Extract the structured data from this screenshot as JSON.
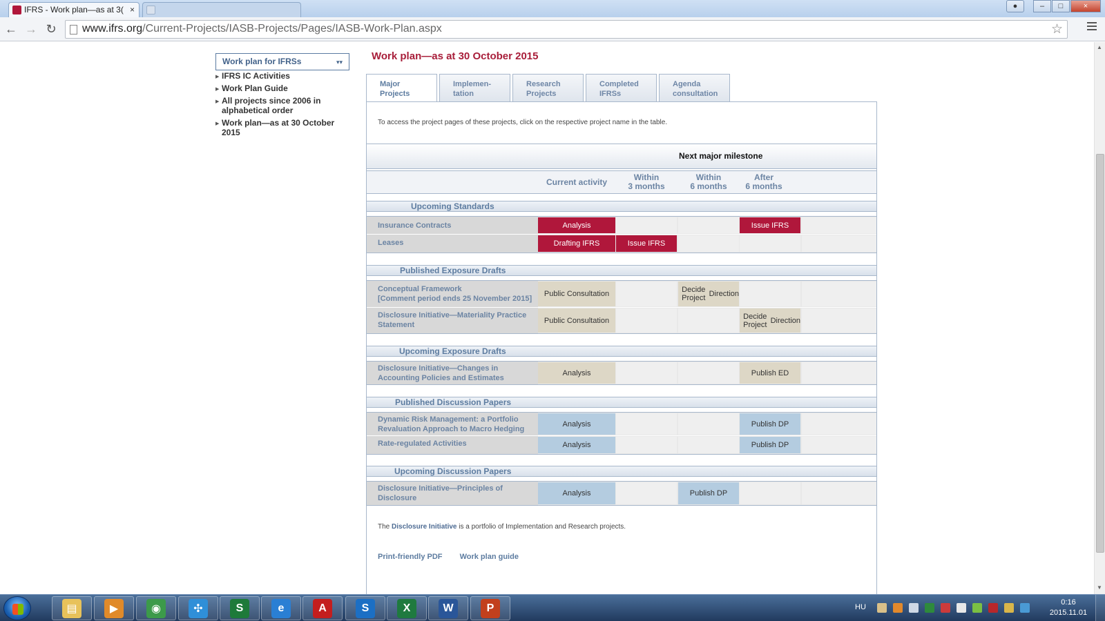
{
  "browser": {
    "tabs": [
      {
        "title": "IFRS - Work plan—as at 3( ",
        "active": true
      },
      {
        "title": "",
        "active": false
      }
    ],
    "tab_close_glyph": "×",
    "url_host": "www.ifrs.org",
    "url_path": "/Current-Projects/IASB-Projects/Pages/IASB-Work-Plan.aspx",
    "window_buttons": {
      "minimize": "–",
      "maximize": "□",
      "close": "×"
    }
  },
  "sidebar": {
    "select_label": "Work plan for IFRSs",
    "items": [
      {
        "label": "IFRS IC Activities"
      },
      {
        "label": "Work Plan Guide"
      },
      {
        "label": "All projects since 2006 in alphabetical order"
      },
      {
        "label": "Work plan—as at 30 October 2015"
      }
    ]
  },
  "main": {
    "title": "Work plan—as at 30 October 2015",
    "tabs": [
      {
        "line1": "Major",
        "line2": "Projects",
        "active": true
      },
      {
        "line1": "Implemen-",
        "line2": "tation",
        "active": false
      },
      {
        "line1": "Research",
        "line2": "Projects",
        "active": false
      },
      {
        "line1": "Completed",
        "line2": "IFRSs",
        "active": false
      },
      {
        "line1": "Agenda",
        "line2": "consultation",
        "active": false
      }
    ],
    "intro": "To access the project pages of these projects, click on the respective project name in the table.",
    "milestone_header": "Next major milestone",
    "columns": {
      "current": "Current activity",
      "within3_l1": "Within",
      "within3_l2": "3 months",
      "within6_l1": "Within",
      "within6_l2": "6 months",
      "after6_l1": "After",
      "after6_l2": "6 months"
    },
    "sections": {
      "upcoming_standards": "Upcoming Standards",
      "published_eds": "Published Exposure Drafts",
      "upcoming_eds": "Upcoming Exposure Drafts",
      "published_dps": "Published Discussion Papers",
      "upcoming_dps": "Upcoming Discussion Papers"
    },
    "rows": {
      "insurance": {
        "name": "Insurance Contracts",
        "current": "Analysis",
        "after6": "Issue IFRS"
      },
      "leases": {
        "name": "Leases",
        "current": "Drafting IFRS",
        "within3": "Issue IFRS"
      },
      "conceptual": {
        "name_l1": "Conceptual Framework",
        "name_l2": "[Comment period ends 25 November 2015]",
        "current": "Public Consultation",
        "within6_l1": "Decide Project",
        "within6_l2": "Direction"
      },
      "materiality": {
        "name_l1": "Disclosure Initiative—Materiality Practice",
        "name_l2": "Statement",
        "current": "Public Consultation",
        "after6_l1": "Decide Project",
        "after6_l2": "Direction"
      },
      "changes": {
        "name_l1": "Disclosure Initiative—Changes in",
        "name_l2": "Accounting Policies and Estimates",
        "current": "Analysis",
        "after6": "Publish ED"
      },
      "drm": {
        "name_l1": "Dynamic Risk Management: a Portfolio",
        "name_l2": "Revaluation Approach to Macro Hedging",
        "current": "Analysis",
        "after6": "Publish DP"
      },
      "rate": {
        "name": "Rate-regulated Activities",
        "current": "Analysis",
        "after6": "Publish DP"
      },
      "principles": {
        "name_l1": "Disclosure Initiative—Principles of",
        "name_l2": "Disclosure",
        "current": "Analysis",
        "within6": "Publish DP"
      }
    },
    "footnote_pre": "The ",
    "footnote_link": "Disclosure Initiative",
    "footnote_post": " is a portfolio of Implementation and Research projects.",
    "links": {
      "print": "Print-friendly PDF",
      "guide": "Work plan guide"
    }
  },
  "taskbar": {
    "apps": [
      {
        "name": "file-explorer-icon",
        "glyph": "▤",
        "color": "#e8c25a"
      },
      {
        "name": "media-player-icon",
        "glyph": "▶",
        "color": "#e08a2a"
      },
      {
        "name": "chrome-icon",
        "glyph": "◉",
        "color": "#3c9a4a"
      },
      {
        "name": "network-app-icon",
        "glyph": "✣",
        "color": "#2f8fd8"
      },
      {
        "name": "finance-app-icon",
        "glyph": "S",
        "color": "#1e7a3a"
      },
      {
        "name": "internet-explorer-icon",
        "glyph": "e",
        "color": "#2a7fd4"
      },
      {
        "name": "acrobat-icon",
        "glyph": "A",
        "color": "#c41e1e"
      },
      {
        "name": "sap-icon",
        "glyph": "S",
        "color": "#1c6fc4"
      },
      {
        "name": "excel-icon",
        "glyph": "X",
        "color": "#1f7a3f"
      },
      {
        "name": "word-icon",
        "glyph": "W",
        "color": "#2a5699"
      },
      {
        "name": "powerpoint-icon",
        "glyph": "P",
        "color": "#c2401d"
      }
    ],
    "language": "HU",
    "time": "0:16",
    "date": "2015.11.01"
  }
}
